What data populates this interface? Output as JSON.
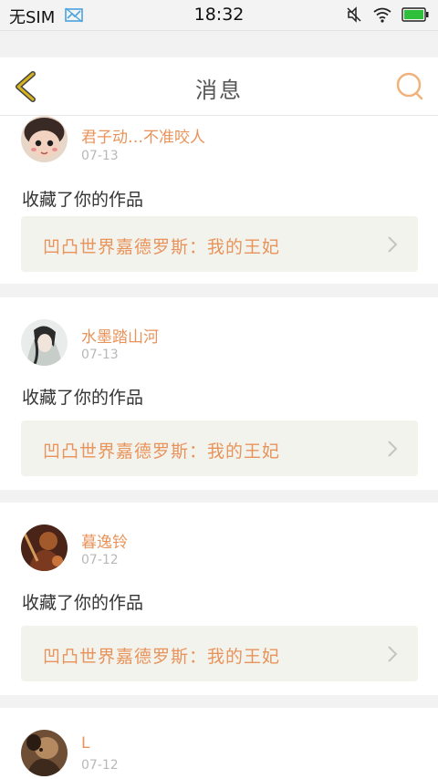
{
  "status_bar": {
    "carrier": "无SIM",
    "time": "18:32"
  },
  "nav": {
    "title": "消息"
  },
  "messages": [
    {
      "user_name": "君子动…不准咬人",
      "date": "07-13",
      "action": "收藏了你的作品",
      "work_title": "凹凸世界嘉德罗斯：我的王妃",
      "avatar_color": "#c98a70"
    },
    {
      "user_name": "水墨踏山河",
      "date": "07-13",
      "action": "收藏了你的作品",
      "work_title": "凹凸世界嘉德罗斯：我的王妃",
      "avatar_color": "#9aa6a0"
    },
    {
      "user_name": "暮逸铃",
      "date": "07-12",
      "action": "收藏了你的作品",
      "work_title": "凹凸世界嘉德罗斯：我的王妃",
      "avatar_color": "#6b3a2a"
    },
    {
      "user_name": "L",
      "date": "07-12"
    }
  ],
  "colors": {
    "accent": "#e8935b",
    "back_icon": "#d6b31e",
    "search_icon": "#f0b27a",
    "battery": "#2fbf3a"
  },
  "icons": {
    "signal_off": "no-signal-icon",
    "mute": "mute-icon",
    "wifi": "wifi-icon",
    "battery": "battery-icon",
    "back": "back-arrow-icon",
    "search": "search-icon",
    "chevron": "chevron-right-icon"
  }
}
